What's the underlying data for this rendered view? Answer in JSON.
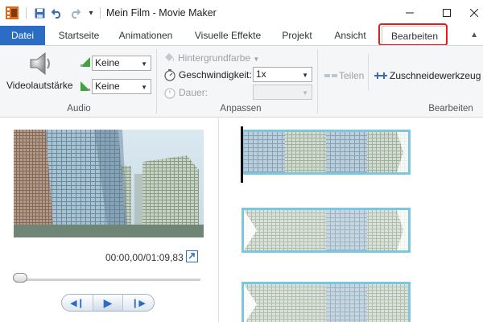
{
  "window": {
    "title": "Mein Film - Movie Maker"
  },
  "tabs": [
    {
      "label": "Datei"
    },
    {
      "label": "Startseite"
    },
    {
      "label": "Animationen"
    },
    {
      "label": "Visuelle Effekte"
    },
    {
      "label": "Projekt"
    },
    {
      "label": "Ansicht"
    },
    {
      "label": "Bearbeiten"
    }
  ],
  "ribbon": {
    "audio": {
      "group_label": "Audio",
      "volume_label": "Videolautstärke",
      "fade_in_value": "Keine",
      "fade_out_value": "Keine"
    },
    "anpassen": {
      "group_label": "Anpassen",
      "background_color_label": "Hintergrundfarbe",
      "speed_label": "Geschwindigkeit:",
      "speed_value": "1x",
      "duration_label": "Dauer:",
      "duration_value": ""
    },
    "bearbeiten": {
      "group_label": "Bearbeiten",
      "split_label": "Teilen",
      "trim_label": "Zuschneidewerkzeug"
    }
  },
  "preview": {
    "timecode": "00:00,00/01:09,83",
    "slider_position": 0.0
  },
  "colors": {
    "file_tab": "#2b6cc4",
    "highlight": "#e21d1d",
    "clip_border": "#7cc6de",
    "accent": "#2b6cc4"
  }
}
